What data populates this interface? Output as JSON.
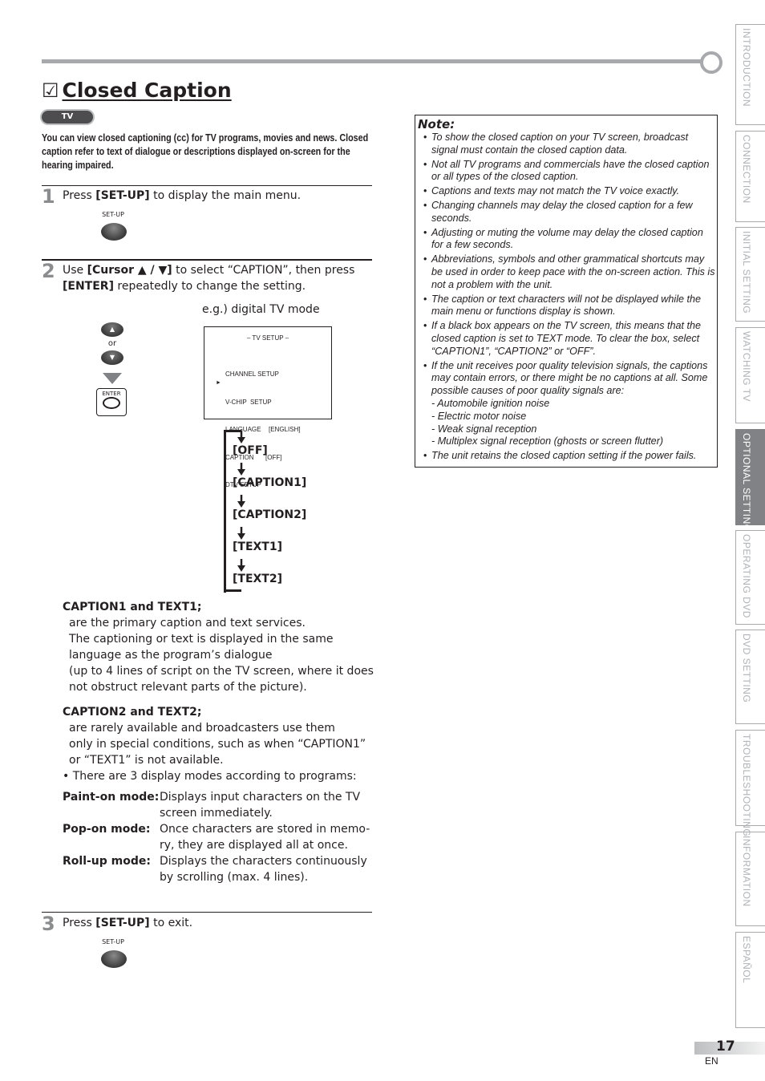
{
  "header": {
    "title": "Closed Caption",
    "checkbox_glyph": "☑",
    "badge": "TV",
    "intro": "You can view closed captioning (cc) for TV programs, movies and news. Closed caption refer to text of dialogue or descriptions displayed on-screen for the hearing impaired."
  },
  "steps": [
    {
      "number": "1",
      "pre": "Press ",
      "bold": "[SET-UP]",
      "post": " to display the main menu.",
      "button_label": "SET-UP"
    },
    {
      "number": "2",
      "line1_pre": "Use ",
      "line1_bold": "[Cursor ▲ / ▼]",
      "line1_post": " to select “CAPTION”, then press",
      "line2_bold": "[ENTER]",
      "line2_post": " repeatedly to change the setting."
    },
    {
      "number": "3",
      "pre": "Press ",
      "bold": "[SET-UP]",
      "post": " to exit.",
      "button_label": "SET-UP"
    }
  ],
  "remote": {
    "up_glyph": "▲",
    "or": "or",
    "down_glyph": "▼",
    "enter_label": "ENTER"
  },
  "tv_screen": {
    "caption": "e.g.) digital TV mode",
    "header": "– TV SETUP –",
    "cursor": "►",
    "menu_items": [
      {
        "label": "CHANNEL SETUP",
        "value": ""
      },
      {
        "label": "V-CHIP  SETUP",
        "value": ""
      },
      {
        "label": "LANGUAGE",
        "value": "[ENGLISH]"
      },
      {
        "label": "CAPTION",
        "value": "[OFF]",
        "selected": true
      },
      {
        "label": "DTV SETUP",
        "value": ""
      }
    ]
  },
  "cycle": [
    "[OFF]",
    "[CAPTION1]",
    "[CAPTION2]",
    "[TEXT1]",
    "[TEXT2]"
  ],
  "caption1": {
    "heading": "CAPTION1 and TEXT1;",
    "lines": [
      "are the primary caption and text services.",
      "The captioning or text is displayed in the same",
      "language as the program’s dialogue",
      "(up to 4 lines of script on the TV screen, where it does",
      "not obstruct relevant parts of the picture)."
    ]
  },
  "caption2": {
    "heading": "CAPTION2 and TEXT2;",
    "lines": [
      "are rarely available and broadcasters use them",
      "only in special conditions, such as when “CAPTION1”",
      "or “TEXT1” is not available."
    ],
    "bullet": "• There are 3 display modes according to programs:"
  },
  "modes": [
    {
      "label": "Paint-on mode:",
      "desc1": "Displays input characters on the TV",
      "desc2": "screen immediately."
    },
    {
      "label": "Pop-on mode:",
      "desc1": "Once characters are stored in memo-",
      "desc2": "ry, they are displayed all at once."
    },
    {
      "label": "Roll-up mode:",
      "desc1": "Displays the characters continuously",
      "desc2": "by scrolling (max. 4 lines)."
    }
  ],
  "note": {
    "title": "Note:",
    "items": [
      "To show the closed caption on your TV screen, broadcast signal must contain the closed caption data.",
      "Not all TV programs and commercials have the closed caption or all types of the closed caption.",
      "Captions and texts may not match the TV voice exactly.",
      "Changing channels may delay the closed caption for a few seconds.",
      "Adjusting or muting the volume may delay the closed caption for a few seconds.",
      "Abbreviations, symbols and other grammatical shortcuts may be used in order to keep pace with the on-screen action. This is not a problem with the unit.",
      "The caption or text characters will not be displayed while the main menu or functions display is shown.",
      "If a black box appears on the TV screen, this means that the closed caption is set to TEXT mode. To clear the box, select “CAPTION1”, “CAPTION2” or “OFF”.",
      "If the unit receives poor quality television signals, the captions may contain errors, or there might be no captions at all. Some possible causes of poor quality signals are:",
      "The unit retains the closed caption setting if the power fails."
    ],
    "causes": [
      "- Automobile ignition noise",
      "- Electric motor noise",
      "- Weak signal reception",
      "- Multiplex signal reception (ghosts or screen flutter)"
    ]
  },
  "side_tabs": [
    {
      "label": "INTRODUCTION",
      "active": false
    },
    {
      "label": "CONNECTION",
      "active": false
    },
    {
      "label": "INITIAL  SETTING",
      "active": false
    },
    {
      "label": "WATCHING  TV",
      "active": false
    },
    {
      "label": "OPTIONAL  SETTING",
      "active": true
    },
    {
      "label": "OPERATING  DVD",
      "active": false
    },
    {
      "label": "DVD  SETTING",
      "active": false
    },
    {
      "label": "TROUBLESHOOTING",
      "active": false
    },
    {
      "label": "INFORMATION",
      "active": false
    },
    {
      "label": "ESPAÑOL",
      "active": false
    }
  ],
  "footer": {
    "page_number": "17",
    "language": "EN"
  },
  "colors": {
    "rule_gray": "#a7a9ac",
    "active_tab": "#808285",
    "step_number": "#8a8c8e"
  }
}
